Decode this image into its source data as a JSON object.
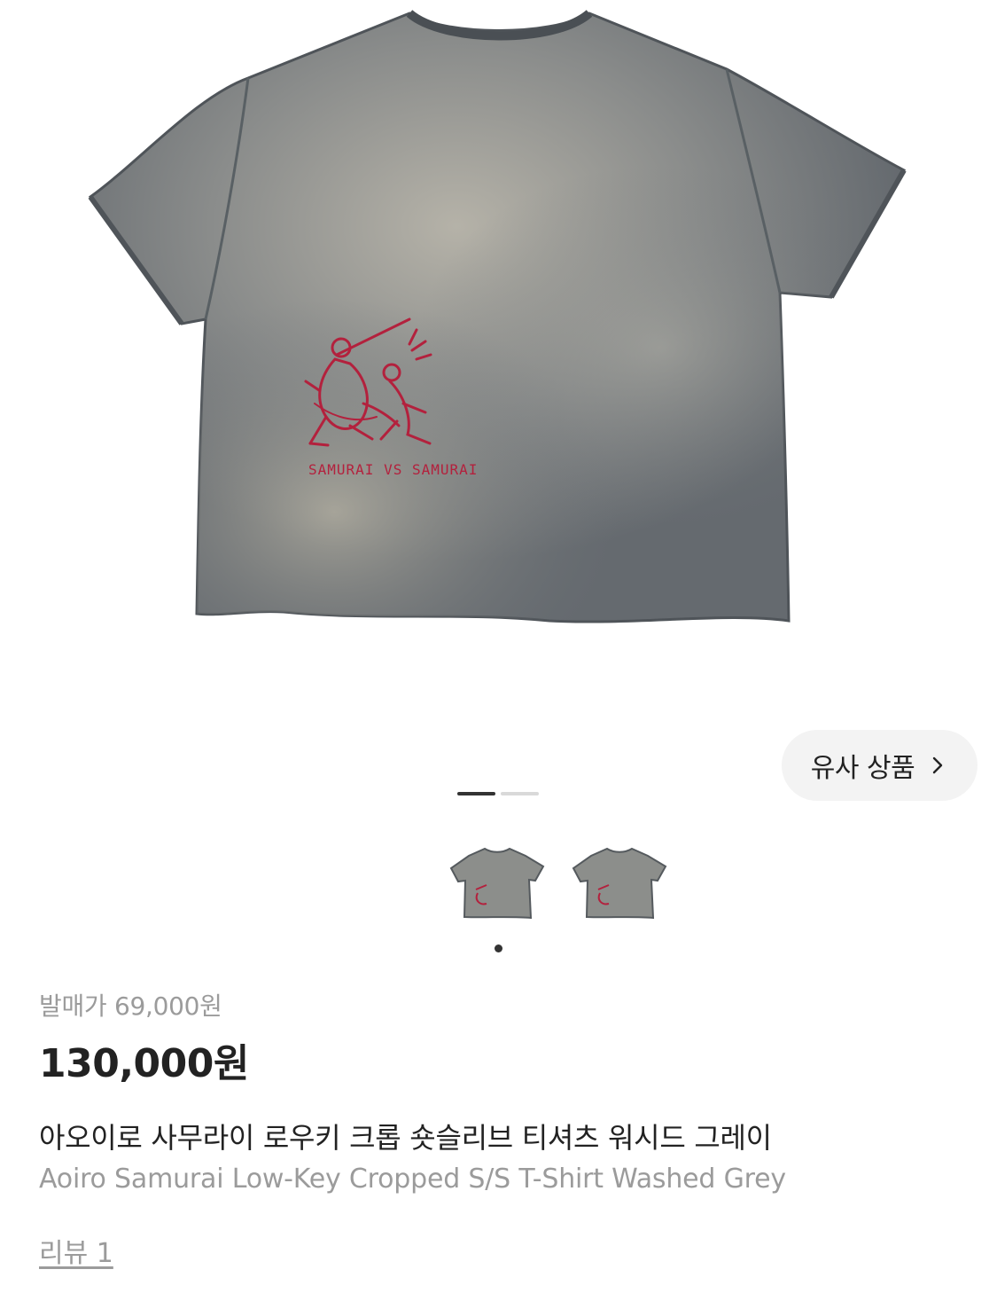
{
  "product": {
    "release_price": "발매가 69,000원",
    "price": "130,000원",
    "name_ko": "아오이로 사무라이 로우키 크롭 숏슬리브 티셔츠 워시드 그레이",
    "name_en": "Aoiro Samurai Low-Key Cropped S/S T-Shirt Washed Grey",
    "review_link": "리뷰 1"
  },
  "gallery": {
    "similar_products_label": "유사 상품",
    "page_count": 2,
    "active_page": 1,
    "thumbnail_count": 2,
    "main_image": "grey-cropped-tshirt-back-with-red-samurai-embroidery",
    "print_text": "SAMURAI VS SAMURAI"
  },
  "colors": {
    "shirt": "#6f7479",
    "shirt_light": "#a7a59c",
    "print": "#b3213d",
    "pager_active": "#333333",
    "pager_inactive": "#d9d9d9",
    "muted_text": "#9b9b9b"
  }
}
